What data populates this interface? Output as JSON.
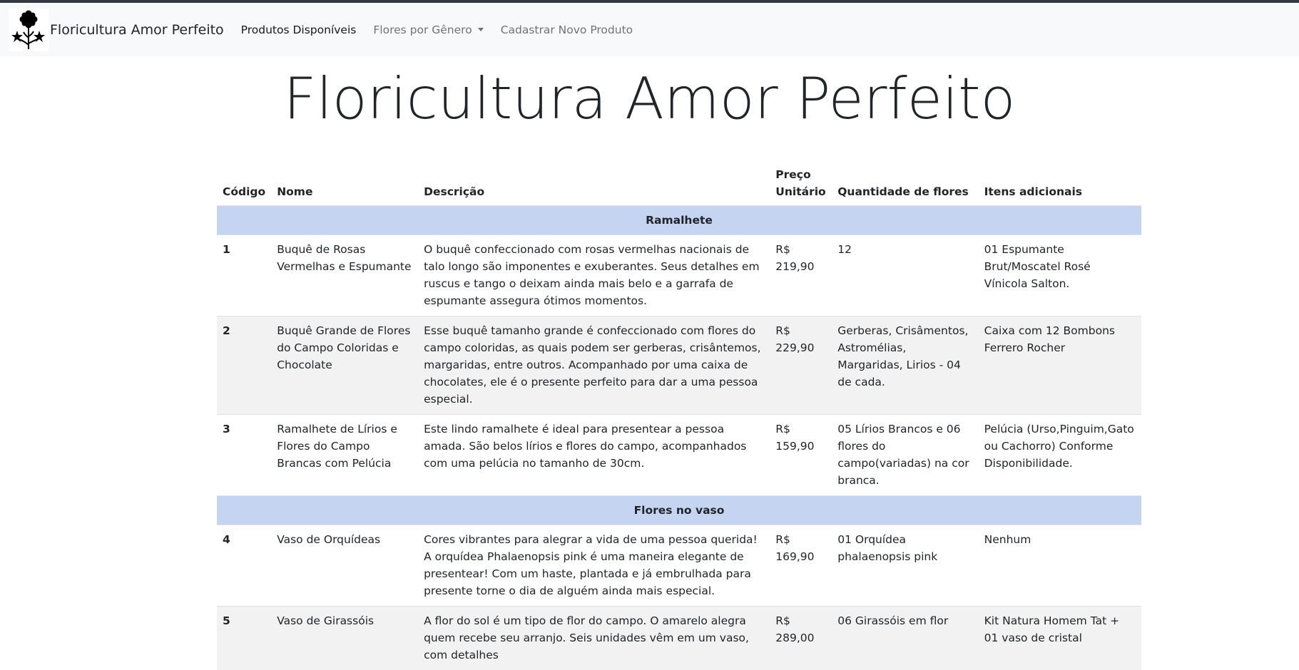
{
  "navbar": {
    "brand": "Floricultura Amor Perfeito",
    "links": [
      {
        "label": "Produtos Disponíveis"
      },
      {
        "label": "Flores por Gênero"
      },
      {
        "label": "Cadastrar Novo Produto"
      }
    ]
  },
  "page": {
    "title": "Floricultura Amor Perfeito"
  },
  "table": {
    "headers": {
      "code": "Código",
      "name": "Nome",
      "description": "Descrição",
      "price_line1": "Preço",
      "price_line2": "Unitário",
      "quantity": "Quantidade de flores",
      "extras": "Itens adicionais"
    },
    "groups": [
      {
        "title": "Ramalhete",
        "rows": [
          {
            "code": "1",
            "name": "Buquê de Rosas Vermelhas e Espumante",
            "description": "O buquê confeccionado com rosas vermelhas nacionais de talo longo são imponentes e exuberantes. Seus detalhes em ruscus e tango o deixam ainda mais belo e a garrafa de espumante assegura ótimos momentos.",
            "price": "R$ 219,90",
            "quantity": "12",
            "extras": "01 Espumante Brut/Moscatel Rosé Vínicola Salton."
          },
          {
            "code": "2",
            "name": "Buquê Grande de Flores do Campo Coloridas e Chocolate",
            "description": "Esse buquê tamanho grande é confeccionado com flores do campo coloridas, as quais podem ser gerberas, crisântemos, margaridas, entre outros. Acompanhado por uma caixa de chocolates, ele é o presente perfeito para dar a uma pessoa especial.",
            "price": "R$ 229,90",
            "quantity": "Gerberas, Crisâmentos, Astromélias, Margaridas, Lirios - 04 de cada.",
            "extras": "Caixa com 12 Bombons Ferrero Rocher"
          },
          {
            "code": "3",
            "name": "Ramalhete de Lírios e Flores do Campo Brancas com Pelúcia",
            "description": "Este lindo ramalhete é ideal para presentear a pessoa amada. São belos lírios e flores do campo, acompanhados com uma pelúcia no tamanho de 30cm.",
            "price": "R$ 159,90",
            "quantity": "05 Lírios Brancos e 06 flores do campo(variadas) na cor branca.",
            "extras": "Pelúcia (Urso,Pinguim,Gato ou Cachorro) Conforme Disponibilidade."
          }
        ]
      },
      {
        "title": "Flores no vaso",
        "rows": [
          {
            "code": "4",
            "name": "Vaso de Orquídeas",
            "description": "Cores vibrantes para alegrar a vida de uma pessoa querida! A orquídea Phalaenopsis pink é uma maneira elegante de presentear! Com um haste, plantada e já embrulhada para presente torne o dia de alguém ainda mais especial.",
            "price": "R$ 169,90",
            "quantity": "01 Orquídea phalaenopsis pink",
            "extras": "Nenhum"
          },
          {
            "code": "5",
            "name": "Vaso de Girassóis",
            "description": "A flor do sol é um tipo de flor do campo. O amarelo alegra quem recebe seu arranjo. Seis unidades vêm em um vaso, com detalhes",
            "price": "R$ 289,00",
            "quantity": "06 Girassóis em flor",
            "extras": "Kit Natura Homem Tat + 01 vaso de cristal"
          }
        ]
      }
    ]
  }
}
